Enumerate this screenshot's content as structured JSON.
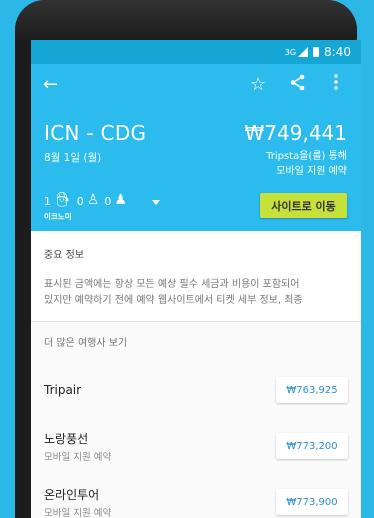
{
  "statusbar": {
    "network": "3G",
    "time": "8:40"
  },
  "flight": {
    "route": "ICN - CDG",
    "date": "8월 1일 (월)",
    "price": "₩749,441",
    "via_line1": "Tripsta을(를) 통해",
    "via_line2": "모바일 지원 예약",
    "adults": "1",
    "children": "0",
    "infants": "0",
    "cabin": "이코노미",
    "cta_label": "사이트로 이동"
  },
  "important": {
    "title": "중요 정보",
    "line1": "표시된 금액에는 항상 모든 예상 필수 세금과 비용이 포함되어",
    "line2": "있지만 예약하기 전에 예약 웹사이트에서 티켓 세부 정보, 최종"
  },
  "more_title": "더 많은 여행사 보기",
  "agencies": [
    {
      "name": "Tripair",
      "sub": "",
      "price": "₩763,925"
    },
    {
      "name": "노랑풍선",
      "sub": "모바일 지원 예약",
      "price": "₩773,200"
    },
    {
      "name": "온라인투어",
      "sub": "모바일 지원 예약",
      "price": "₩773,900"
    }
  ]
}
